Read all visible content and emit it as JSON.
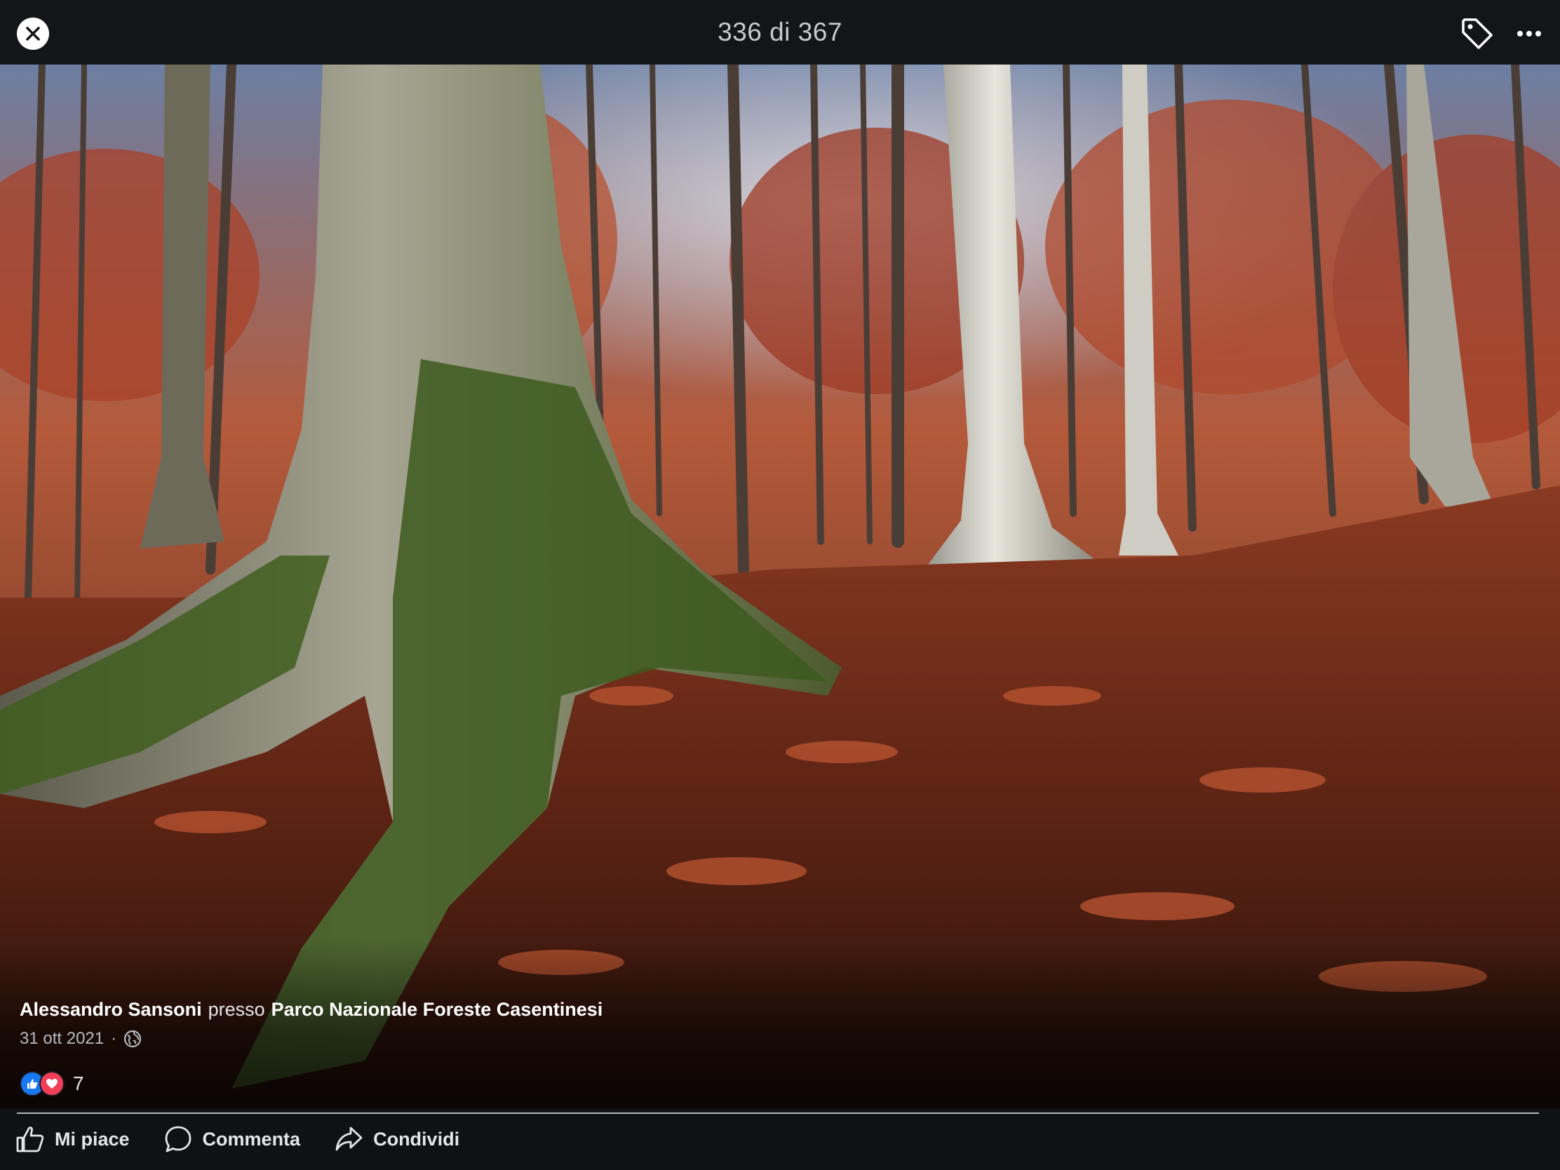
{
  "header": {
    "counter": "336 di 367",
    "close_icon": "close-icon",
    "tag_icon": "tag-icon",
    "more_icon": "more-horizontal-icon"
  },
  "photo": {
    "description_icon": "forest-photo"
  },
  "post": {
    "author": "Alessandro Sansoni",
    "connector": "presso",
    "location": "Parco Nazionale Foreste Casentinesi",
    "date": "31 ott 2021",
    "separator": "·",
    "privacy_icon": "globe-icon"
  },
  "reactions": {
    "count": "7",
    "icons": [
      "like-reaction-icon",
      "love-reaction-icon"
    ]
  },
  "actions": {
    "like_label": "Mi piace",
    "comment_label": "Commenta",
    "share_label": "Condividi"
  },
  "colors": {
    "background": "#101114",
    "like_blue": "#1877f2",
    "love_red": "#f33e58"
  }
}
